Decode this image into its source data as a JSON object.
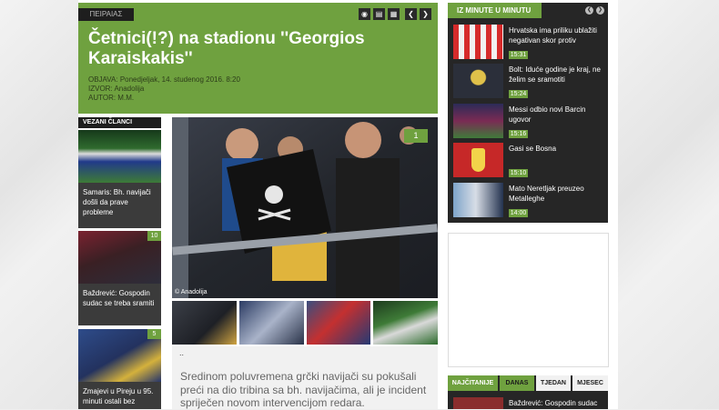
{
  "header": {
    "tag": "ΠΕΙΡΑΙΑΣ",
    "icons": [
      "rss-icon",
      "share-icon",
      "print-icon",
      "prev-arrow-icon",
      "next-arrow-icon"
    ],
    "title": "Četnici(!?) na stadionu ''Georgios Karaiskakis''",
    "meta": {
      "published": "OBJAVA: Ponedjeljak, 14. studenog 2016. 8:20",
      "source": "IZVOR: Anadolija",
      "author": "AUTOR: M.M."
    }
  },
  "related": {
    "heading": "VEZANI ČLANCI",
    "items": [
      {
        "text": "Samaris: Bh. navijači došli da prave probleme",
        "badge": ""
      },
      {
        "text": "Baždrević: Gospodin sudac se treba sramiti",
        "badge": "10"
      },
      {
        "text": "Zmajevi u Pireju u 95. minuti ostali bez",
        "badge": "5"
      }
    ]
  },
  "photo": {
    "badge": "1",
    "credit": "© Anadolija"
  },
  "article": {
    "dots": "..",
    "lead": "Sredinom poluvremena grčki navijači su pokušali preći na dio tribina sa bh. navijačima, ali je incident spriječen novom intervencijom redara."
  },
  "iz_minute": {
    "heading": "IZ MINUTE U MINUTU",
    "items": [
      {
        "text": "Hrvatska ima priliku ublažiti negativan skor protiv",
        "time": "15:31"
      },
      {
        "text": "Bolt: Iduće godine je kraj, ne želim se sramotiti",
        "time": "15:24"
      },
      {
        "text": "Messi odbio novi Barcin ugovor",
        "time": "15:16"
      },
      {
        "text": "Gasi se Bosna",
        "time": "15:10"
      },
      {
        "text": "Mato Neretljak preuzeo Metalleghe",
        "time": "14:00"
      }
    ]
  },
  "najcitanije": {
    "heading": "NAJČITANIJE",
    "tabs": [
      "DANAS",
      "TJEDAN",
      "MJESEC"
    ],
    "first_item": "Baždrević: Gospodin sudac"
  },
  "colors": {
    "accent": "#6fa13f",
    "dark": "#262626"
  }
}
